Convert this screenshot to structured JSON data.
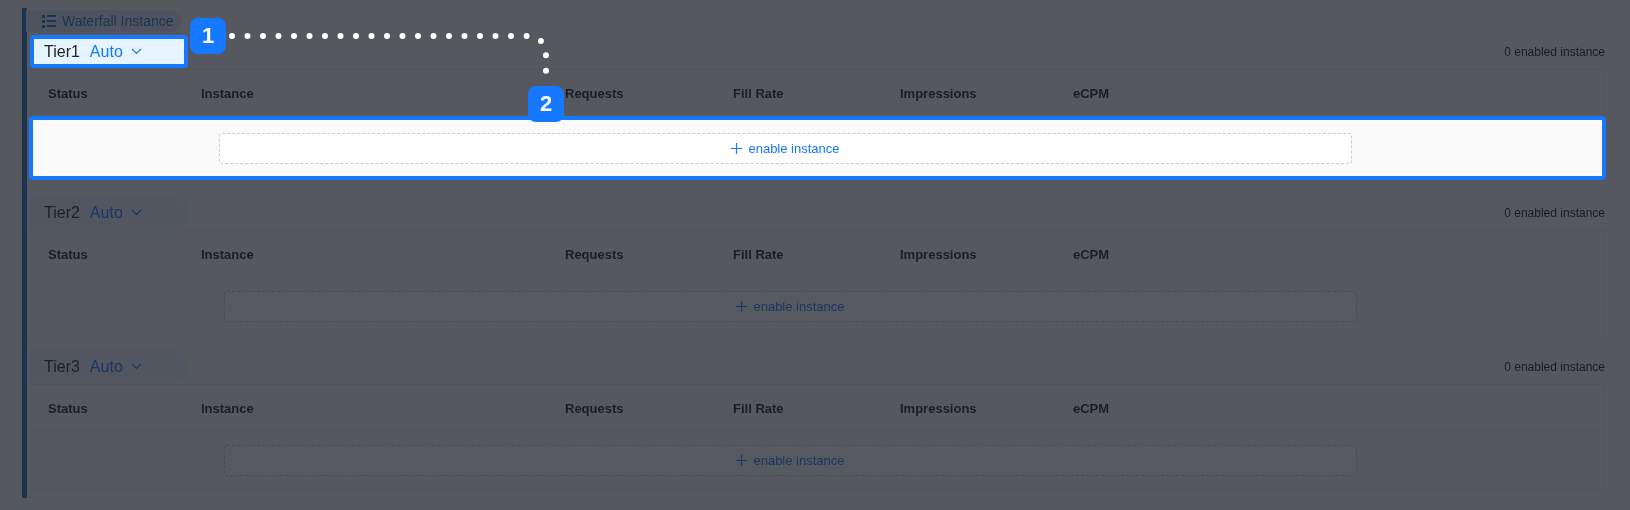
{
  "section": {
    "title": "Waterfall Instance"
  },
  "tiers": [
    {
      "name": "Tier1",
      "mode": "Auto",
      "count": "0 enabled instance",
      "spotlight": true,
      "columns": [
        "Status",
        "Instance",
        "Requests",
        "Fill Rate",
        "Impressions",
        "eCPM"
      ],
      "add_label": "enable instance"
    },
    {
      "name": "Tier2",
      "mode": "Auto",
      "count": "0 enabled instance",
      "spotlight": false,
      "columns": [
        "Status",
        "Instance",
        "Requests",
        "Fill Rate",
        "Impressions",
        "eCPM"
      ],
      "add_label": "enable instance"
    },
    {
      "name": "Tier3",
      "mode": "Auto",
      "count": "0 enabled instance",
      "spotlight": false,
      "columns": [
        "Status",
        "Instance",
        "Requests",
        "Fill Rate",
        "Impressions",
        "eCPM"
      ],
      "add_label": "enable instance"
    }
  ],
  "callouts": [
    "1",
    "2"
  ]
}
